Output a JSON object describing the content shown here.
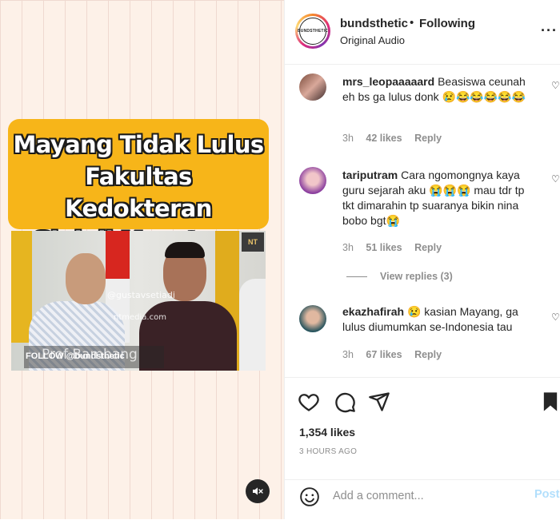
{
  "video": {
    "title_lines": [
      "Mayang Tidak Lulus",
      "Fakultas Kedokteran",
      "Gigi di Moestopo"
    ],
    "watermark_1": "@gustavsetiadi",
    "watermark_2": "ntmedia.com",
    "logo_text": "NT",
    "follow_text": "FOLLOW @bundsthetic",
    "overlay_name": "Prof Bambang",
    "mute_icon": "speaker-muted-icon"
  },
  "header": {
    "avatar_text": "BUNDSTHETIC",
    "username": "bundsthetic",
    "separator": "•",
    "follow_status": "Following",
    "audio": "Original Audio",
    "more_icon": "···"
  },
  "comments": [
    {
      "user": "mrs_leopaaaaard",
      "text": "Beasiswa ceunah eh bs ga lulus donk 😢😂😂😂😂😂",
      "time": "3h",
      "likes": "42 likes",
      "reply": "Reply"
    },
    {
      "user": "tariputram",
      "text": "Cara ngomongnya kaya guru sejarah aku 😭😭😭 mau tdr tp tkt dimarahin tp suaranya bikin nina bobo bgt😭",
      "time": "3h",
      "likes": "51 likes",
      "reply": "Reply"
    },
    {
      "user": "ekazhafirah",
      "text": "😢 kasian Mayang, ga lulus diumumkan se-Indonesia tau",
      "time": "3h",
      "likes": "67 likes",
      "reply": "Reply"
    }
  ],
  "view_replies": "View replies (3)",
  "post": {
    "likes": "1,354 likes",
    "time_ago": "3 HOURS AGO"
  },
  "add_comment": {
    "placeholder": "Add a comment...",
    "post_label": "Post"
  },
  "colors": {
    "title_bg": "#f7b519",
    "post_button": "#b2dffc",
    "muted_text": "#8e8e8e"
  }
}
